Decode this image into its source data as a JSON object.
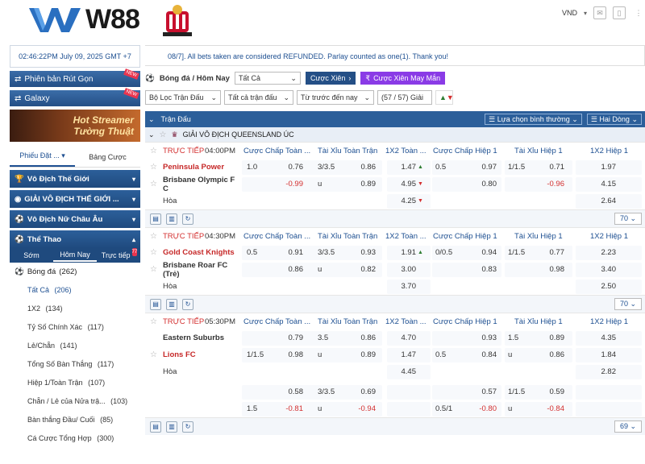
{
  "header": {
    "brand": "W88",
    "currency": "VND"
  },
  "sidebar": {
    "time": "02:46:22PM July 09, 2025 GMT +7",
    "btn1": "Phiên bản Rút Gọn",
    "btn2": "Galaxy",
    "banner_l1": "Hot Streamer",
    "banner_l2": "Tường Thuật",
    "tab1": "Phiếu Đặt ...",
    "tab2": "Bảng Cược",
    "groups": [
      "Vô Địch Thế Giới",
      "GIẢI VÔ ĐỊCH THẾ GIỚI ...",
      "Vô Địch Nữ Châu Âu",
      "Thể Thao"
    ],
    "subtabs": [
      "Sớm",
      "Hôm Nay",
      "Trực tiếp"
    ],
    "live_count": "77",
    "sport": "Bóng đá",
    "sport_count": "(262)",
    "cats": [
      {
        "label": "Tất Cả",
        "count": "(206)"
      },
      {
        "label": "1X2",
        "count": "(134)"
      },
      {
        "label": "Tỷ Số Chính Xác",
        "count": "(117)"
      },
      {
        "label": "Lẻ/Chẵn",
        "count": "(141)"
      },
      {
        "label": "Tổng Số Bàn Thắng",
        "count": "(117)"
      },
      {
        "label": "Hiệp 1/Toàn Trận",
        "count": "(107)"
      },
      {
        "label": "Chẵn / Lẻ của Nửa trậ...",
        "count": "(103)"
      },
      {
        "label": "Bàn thắng Đầu/ Cuối",
        "count": "(85)"
      },
      {
        "label": "Cá Cược Tổng Hợp",
        "count": "(300)"
      }
    ]
  },
  "main": {
    "notice": "08/7]. All bets taken are considered REFUNDED. Parlay counted as one(1). Thank you!",
    "sport_label": "Bóng đá / Hôm Nay",
    "filter_all": "Tất Cả",
    "btn_parlay": "Cược Xiên",
    "btn_lucky": "Cược Xiên May Mắn",
    "filter1": "Bộ Lọc Trận Đấu",
    "filter2": "Tất cả trận đấu",
    "filter3": "Từ trước đến nay",
    "count": "(57 / 57) Giải",
    "tbl_title": "Trận Đấu",
    "sort": "Lựa chọn bình thường",
    "lines": "Hai Dòng",
    "league": "GIẢI VÔ ĐỊCH QUEENSLAND ÚC",
    "cols": [
      "Cược Chấp Toàn ...",
      "Tài Xỉu Toàn Trận",
      "1X2 Toàn ...",
      "Cược Chấp Hiệp 1",
      "Tài Xỉu Hiệp 1",
      "1X2 Hiệp 1"
    ],
    "live": "TRỰC TIẾP",
    "draw": "Hòa",
    "u": "u",
    "m1": {
      "time": "04:00PM",
      "home": "Peninsula Power",
      "away": "Brisbane Olympic F C",
      "r1": [
        "1.0",
        "0.76",
        "3/3.5",
        "0.86",
        "1.47",
        "0.5",
        "0.97",
        "1/1.5",
        "0.71",
        "1.97"
      ],
      "r2": [
        "-0.99",
        "0.89",
        "4.95",
        "0.80",
        "-0.96",
        "4.15"
      ],
      "r3": [
        "4.25",
        "2.64"
      ],
      "more": "70"
    },
    "m2": {
      "time": "04:30PM",
      "home": "Gold Coast Knights",
      "away": "Brisbane Roar FC (Trẻ)",
      "r1": [
        "0.5",
        "0.91",
        "3/3.5",
        "0.93",
        "1.91",
        "0/0.5",
        "0.94",
        "1/1.5",
        "0.77",
        "2.23"
      ],
      "r2": [
        "0.86",
        "0.82",
        "3.00",
        "0.83",
        "0.98",
        "3.40"
      ],
      "r3": [
        "3.70",
        "2.50"
      ],
      "more": "70"
    },
    "m3": {
      "time": "05:30PM",
      "home": "Eastern Suburbs",
      "away": "Lions FC",
      "r1": [
        "0.79",
        "3.5",
        "0.86",
        "4.70",
        "0.93",
        "1.5",
        "0.89",
        "4.35"
      ],
      "r2": [
        "1/1.5",
        "0.98",
        "0.89",
        "1.47",
        "0.5",
        "0.84",
        "0.86",
        "1.84"
      ],
      "r3": [
        "4.45",
        "2.82"
      ],
      "r4": [
        "0.58",
        "3/3.5",
        "0.69",
        "0.57",
        "1/1.5",
        "0.59"
      ],
      "r5": [
        "1.5",
        "-0.81",
        "-0.94",
        "0.5/1",
        "-0.80",
        "-0.84"
      ],
      "more": "69"
    }
  }
}
